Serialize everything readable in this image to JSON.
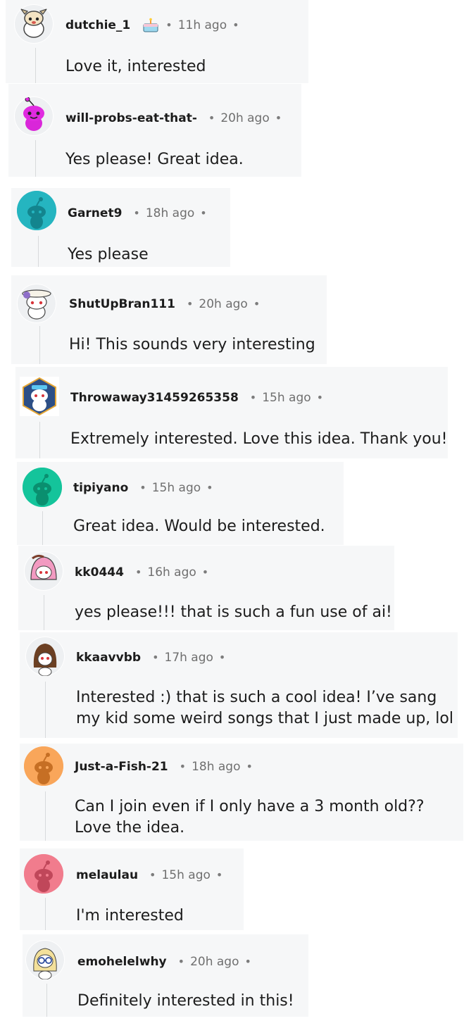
{
  "comments": [
    {
      "username": "dutchie_1",
      "time": "11h ago",
      "text": "Love it, interested",
      "avatar_bg": "#ffffff",
      "avatar_icon": "snoo-dog-avatar-icon",
      "has_flair": true
    },
    {
      "username": "will-probs-eat-that-",
      "time": "20h ago",
      "text": "Yes please! Great idea.",
      "avatar_bg": "#ffffff",
      "avatar_icon": "snoo-magenta-avatar-icon",
      "has_flair": false
    },
    {
      "username": "Garnet9",
      "time": "18h ago",
      "text": "Yes please",
      "avatar_bg": "#25b5c0",
      "avatar_icon": "default-snoo-avatar-icon",
      "has_flair": false
    },
    {
      "username": "ShutUpBran111",
      "time": "20h ago",
      "text": "Hi! This sounds very interesting",
      "avatar_bg": "#ffffff",
      "avatar_icon": "snoo-flower-hat-avatar-icon",
      "has_flair": false
    },
    {
      "username": "Throwaway31459265358",
      "time": "15h ago",
      "text": "Extremely interested. Love this idea. Thank you!",
      "avatar_bg": "#ffffff",
      "avatar_icon": "snoo-hexagon-avatar-icon",
      "has_flair": false
    },
    {
      "username": "tipiyano",
      "time": "15h ago",
      "text": "Great idea. Would be interested.",
      "avatar_bg": "#14c49b",
      "avatar_icon": "default-snoo-avatar-icon",
      "has_flair": false
    },
    {
      "username": "kk0444",
      "time": "16h ago",
      "text": "yes please!!! that is such a fun use of ai!",
      "avatar_bg": "#ffffff",
      "avatar_icon": "snoo-pink-hood-avatar-icon",
      "has_flair": false
    },
    {
      "username": "kkaavvbb",
      "time": "17h ago",
      "text": "Interested :) that is such a cool idea! I’ve sang\nmy kid some weird songs that I just made up, lol",
      "avatar_bg": "#ffffff",
      "avatar_icon": "snoo-brown-hair-avatar-icon",
      "has_flair": false
    },
    {
      "username": "Just-a-Fish-21",
      "time": "18h ago",
      "text": "Can I join even if I only have a 3 month old??\nLove the idea.",
      "avatar_bg": "#f9a65a",
      "avatar_icon": "default-snoo-avatar-icon",
      "has_flair": false
    },
    {
      "username": "melaulau",
      "time": "15h ago",
      "text": "I'm interested",
      "avatar_bg": "#f17c8d",
      "avatar_icon": "default-snoo-avatar-icon",
      "has_flair": false
    },
    {
      "username": "emohelelwhy",
      "time": "20h ago",
      "text": "Definitely interested in this!",
      "avatar_bg": "#ffffff",
      "avatar_icon": "snoo-glasses-avatar-icon",
      "has_flair": false
    }
  ],
  "separator": "•",
  "colors": {
    "card_background": "#f6f7f8",
    "username": "#1c1c1c",
    "timestamp": "#6f6f6f",
    "thread_line": "#d8dadc"
  }
}
